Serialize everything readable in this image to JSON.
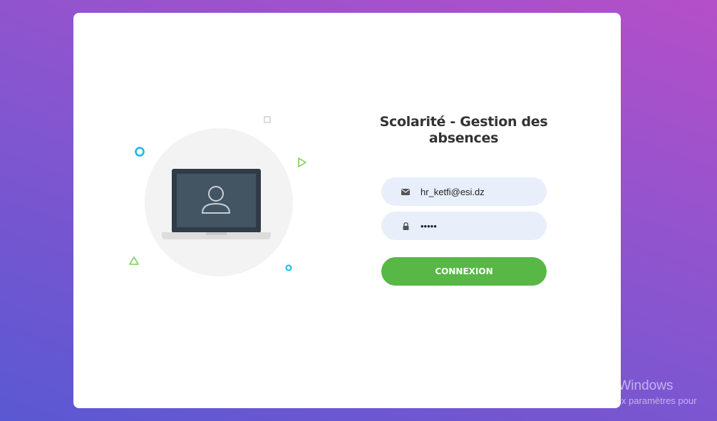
{
  "login": {
    "title": "Scolarité - Gestion des absences",
    "email_value": "hr_ketfi@esi.dz",
    "password_value": "12345",
    "submit_label": "CONNEXION"
  },
  "icons": {
    "email": "envelope-icon",
    "password": "lock-icon",
    "illustration": "laptop-user-icon"
  },
  "colors": {
    "accent_green": "#57b846",
    "field_bg": "#e8effb",
    "title_text": "#333333"
  },
  "watermark": {
    "line1": "Activer Windows",
    "line2": "Accédez aux paramètres pour"
  }
}
